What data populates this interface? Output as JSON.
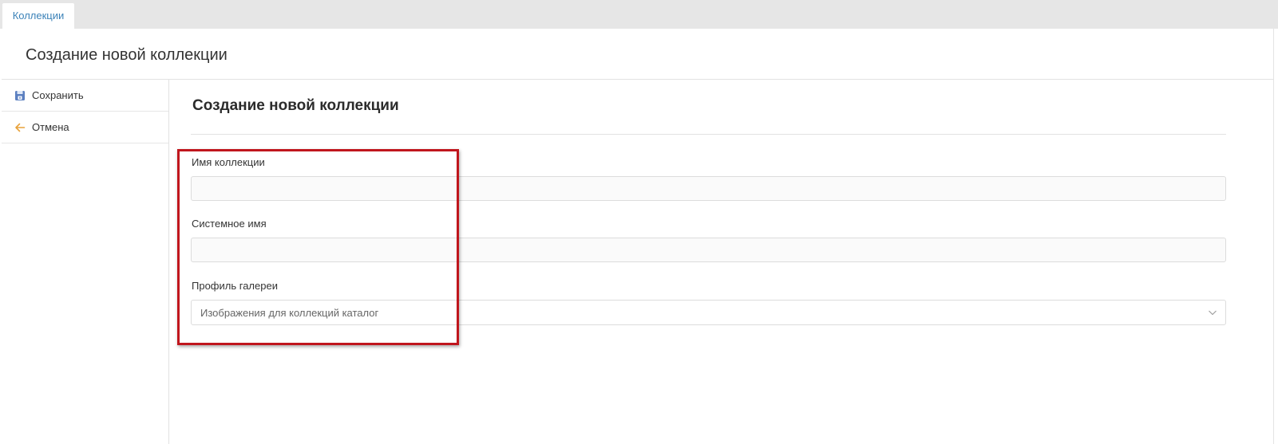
{
  "tabs": [
    {
      "label": "Коллекции"
    }
  ],
  "header": {
    "title": "Создание новой коллекции"
  },
  "sidebar": {
    "items": [
      {
        "label": "Сохранить",
        "icon": "save-icon"
      },
      {
        "label": "Отмена",
        "icon": "arrow-left-icon"
      }
    ]
  },
  "form": {
    "title": "Создание новой коллекции",
    "fields": [
      {
        "label": "Имя коллекции",
        "value": "",
        "placeholder": ""
      },
      {
        "label": "Системное имя",
        "value": "",
        "placeholder": ""
      },
      {
        "label": "Профиль галереи",
        "selected": "Изображения для коллекций каталог"
      }
    ]
  },
  "colors": {
    "tab_text": "#3b82b8",
    "save_icon": "#5b7fc0",
    "cancel_icon": "#e8a23a",
    "highlight_border": "#c0161d"
  }
}
